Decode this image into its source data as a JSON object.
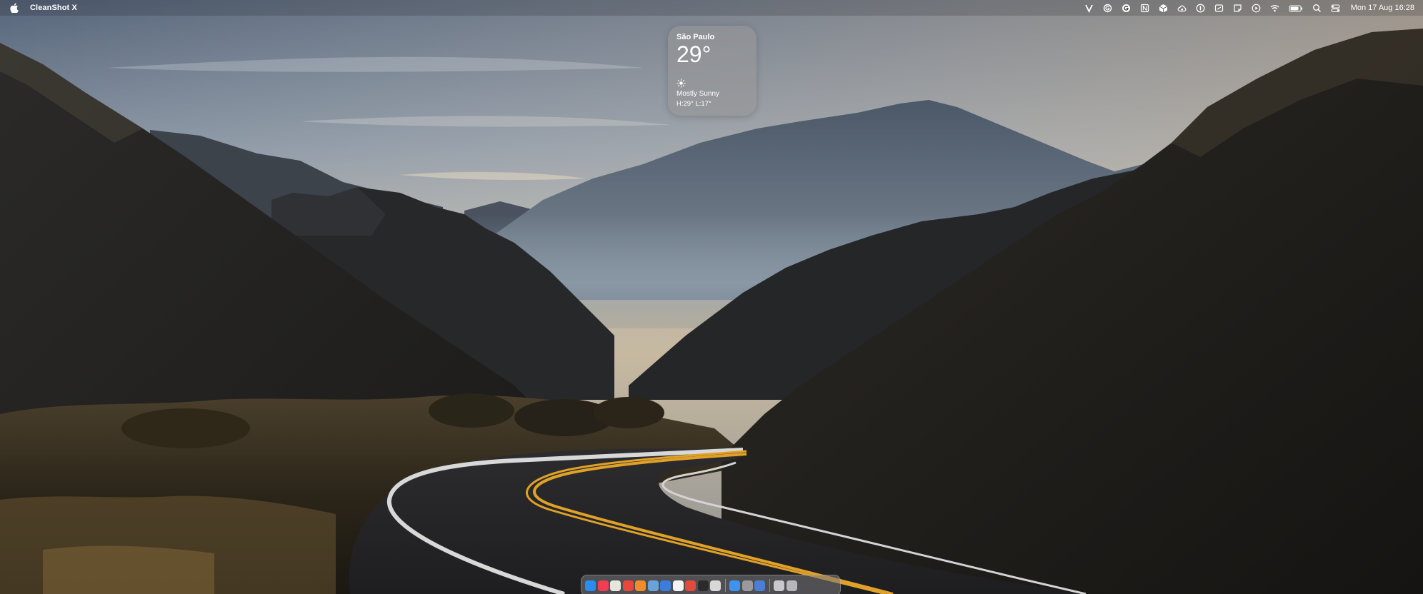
{
  "menubar": {
    "app_name": "CleanShot X",
    "datetime": "Mon 17 Aug  16:28",
    "icons": [
      "vectorize-icon",
      "grammarly-icon",
      "grammarly-g-icon",
      "notion-icon",
      "box-icon",
      "cloud-sync-icon",
      "1password-icon",
      "focus-icon",
      "note-icon",
      "play-icon",
      "wifi-icon",
      "battery-icon",
      "search-icon",
      "control-center-icon"
    ]
  },
  "weather": {
    "city": "São Paulo",
    "temperature": "29°",
    "condition": "Mostly Sunny",
    "high_low": "H:29° L:17°",
    "icon": "sun-icon"
  },
  "dock": {
    "apps": [
      {
        "name": "finder",
        "color": "#2a8cf0"
      },
      {
        "name": "music",
        "color": "#f23d52"
      },
      {
        "name": "photos",
        "color": "#e9e4dc"
      },
      {
        "name": "chrome",
        "color": "#e8483b"
      },
      {
        "name": "photo-app",
        "color": "#f08d2b"
      },
      {
        "name": "preview",
        "color": "#6aa3d9"
      },
      {
        "name": "things",
        "color": "#3b7ddd"
      },
      {
        "name": "notion",
        "color": "#f4f4f4"
      },
      {
        "name": "todoist",
        "color": "#e14a3c"
      },
      {
        "name": "terminal-app",
        "color": "#2b2b2b"
      },
      {
        "name": "ball-app",
        "color": "#d8d8d8"
      },
      {
        "name": "safari",
        "color": "#3a94f0"
      },
      {
        "name": "system-settings",
        "color": "#9a9a9e"
      },
      {
        "name": "browser-app",
        "color": "#4a7fd8"
      },
      {
        "name": "downloads-folder",
        "color": "#c9c9cd"
      },
      {
        "name": "trash",
        "color": "#b7b7bb"
      }
    ]
  }
}
